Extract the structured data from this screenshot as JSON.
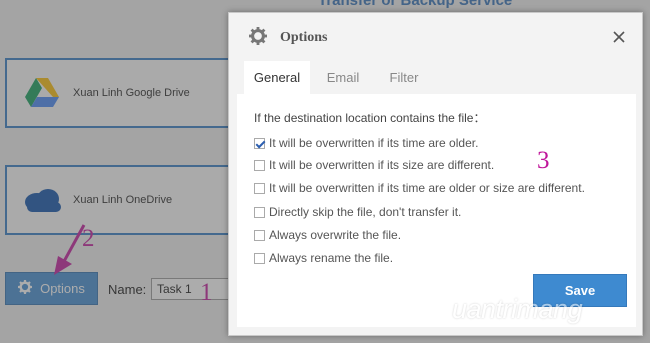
{
  "background": {
    "header_partial": "Transfer or Backup Service",
    "services": [
      {
        "name": "Xuan Linh Google Drive",
        "icon": "google-drive-icon"
      },
      {
        "name": "Xuan Linh OneDrive",
        "icon": "onedrive-icon"
      }
    ],
    "options_button": {
      "label": "Options",
      "icon": "gear-icon"
    },
    "name_field": {
      "label": "Name:",
      "value": "Task 1"
    }
  },
  "annotations": {
    "step1": "1",
    "step2": "2",
    "step3": "3"
  },
  "dialog": {
    "title": "Options",
    "title_icon": "gear-icon",
    "tabs": [
      {
        "label": "General",
        "active": true
      },
      {
        "label": "Email",
        "active": false
      },
      {
        "label": "Filter",
        "active": false
      }
    ],
    "prompt": "If the destination location contains the file：",
    "options": [
      {
        "label": "It will be overwritten if its time are older.",
        "checked": true
      },
      {
        "label": "It will be overwritten if its size are different.",
        "checked": false
      },
      {
        "label": "It will be overwritten if its time are older or size are different.",
        "checked": false
      },
      {
        "label": "Directly skip the file, don't transfer it.",
        "checked": false
      },
      {
        "label": "Always overwrite the file.",
        "checked": false
      },
      {
        "label": "Always rename the file.",
        "checked": false
      }
    ],
    "save_label": "Save"
  },
  "watermark": {
    "text": "uantrimang",
    "icon": "quantrimang-logo-icon"
  },
  "colors": {
    "accent": "#3e8ad0",
    "annotation": "#c0169a",
    "card_border": "#2e78c2"
  }
}
